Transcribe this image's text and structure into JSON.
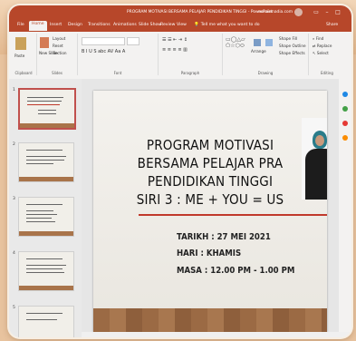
{
  "window": {
    "title": "PROGRAM MOTIVASI BERSAMA PELAJAR PENDIDIKAN TINGGI - PowerPoint",
    "user": "nur.ainnadia.com"
  },
  "tabs": [
    "File",
    "Home",
    "Insert",
    "Design",
    "Transitions",
    "Animations",
    "Slide Show",
    "Review",
    "View",
    "Help"
  ],
  "active_tab": "Home",
  "tellme": "Tell me what you want to do",
  "share": "Share",
  "ribbon": {
    "clipboard": {
      "label": "Clipboard",
      "paste": "Paste"
    },
    "slides": {
      "label": "Slides",
      "new_slide": "New Slide",
      "layout": "Layout",
      "reset": "Reset",
      "section": "Section"
    },
    "font": {
      "label": "Font"
    },
    "paragraph": {
      "label": "Paragraph"
    },
    "drawing": {
      "label": "Drawing",
      "arrange": "Arrange",
      "quick_styles": "Quick Styles",
      "shape_fill": "Shape Fill",
      "shape_outline": "Shape Outline",
      "shape_effects": "Shape Effects"
    },
    "editing": {
      "label": "Editing",
      "find": "Find",
      "replace": "Replace",
      "select": "Select"
    }
  },
  "thumbnails": [
    {
      "number": "1",
      "selected": true
    },
    {
      "number": "2",
      "selected": false
    },
    {
      "number": "3",
      "selected": false
    },
    {
      "number": "4",
      "selected": false
    },
    {
      "number": "5",
      "selected": false
    }
  ],
  "slide": {
    "title_lines": [
      "PROGRAM MOTIVASI",
      "BERSAMA PELAJAR PRA",
      "PENDIDIKAN TINGGI",
      "SIRI 3 : ME + YOU = US"
    ],
    "tarikh": "TARIKH : 27 MEI 2021",
    "hari": "HARI : KHAMIS",
    "masa": "MASA : 12.00 PM - 1.00 PM"
  },
  "colors": {
    "accent": "#b7472a",
    "underline": "#c0392b"
  }
}
